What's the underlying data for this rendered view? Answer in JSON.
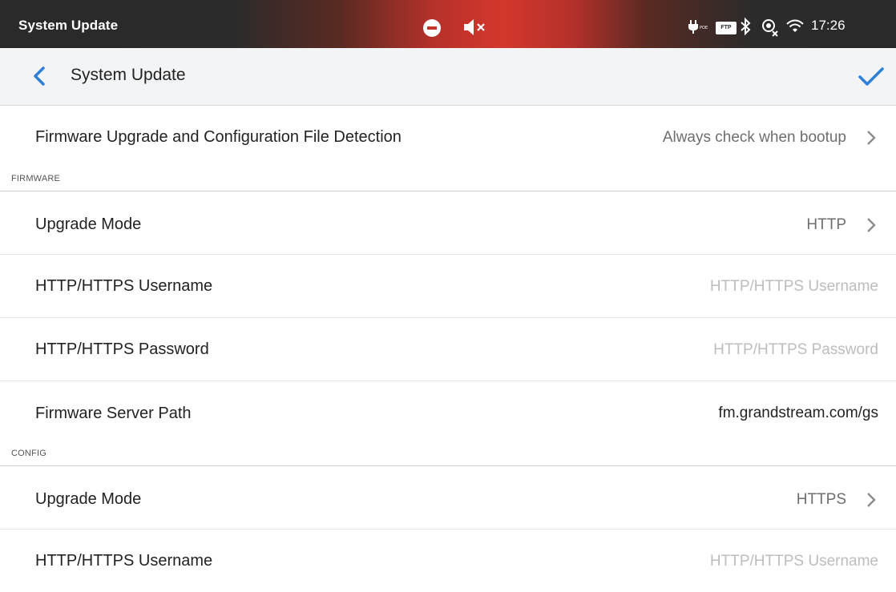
{
  "status_bar": {
    "title": "System Update",
    "ftp_label": "FTP",
    "time": "17:26",
    "icons": [
      "do-not-disturb-icon",
      "mute-icon",
      "poe-plug-icon",
      "ftp-icon",
      "bluetooth-icon",
      "sync-off-icon",
      "wifi-icon"
    ]
  },
  "toolbar": {
    "title": "System Update",
    "back_icon": "chevron-left-icon",
    "confirm_icon": "check-icon",
    "accent_color": "#2f7fd9"
  },
  "detection": {
    "label": "Firmware Upgrade and Configuration File Detection",
    "value": "Always check when bootup"
  },
  "firmware": {
    "header": "FIRMWARE",
    "upgrade_mode": {
      "label": "Upgrade Mode",
      "value": "HTTP"
    },
    "username": {
      "label": "HTTP/HTTPS Username",
      "placeholder": "HTTP/HTTPS Username"
    },
    "password": {
      "label": "HTTP/HTTPS Password",
      "placeholder": "HTTP/HTTPS Password"
    },
    "server_path": {
      "label": "Firmware Server Path",
      "value": "fm.grandstream.com/gs"
    }
  },
  "config": {
    "header": "CONFIG",
    "upgrade_mode": {
      "label": "Upgrade Mode",
      "value": "HTTPS"
    },
    "username": {
      "label": "HTTP/HTTPS Username",
      "placeholder": "HTTP/HTTPS Username"
    }
  }
}
